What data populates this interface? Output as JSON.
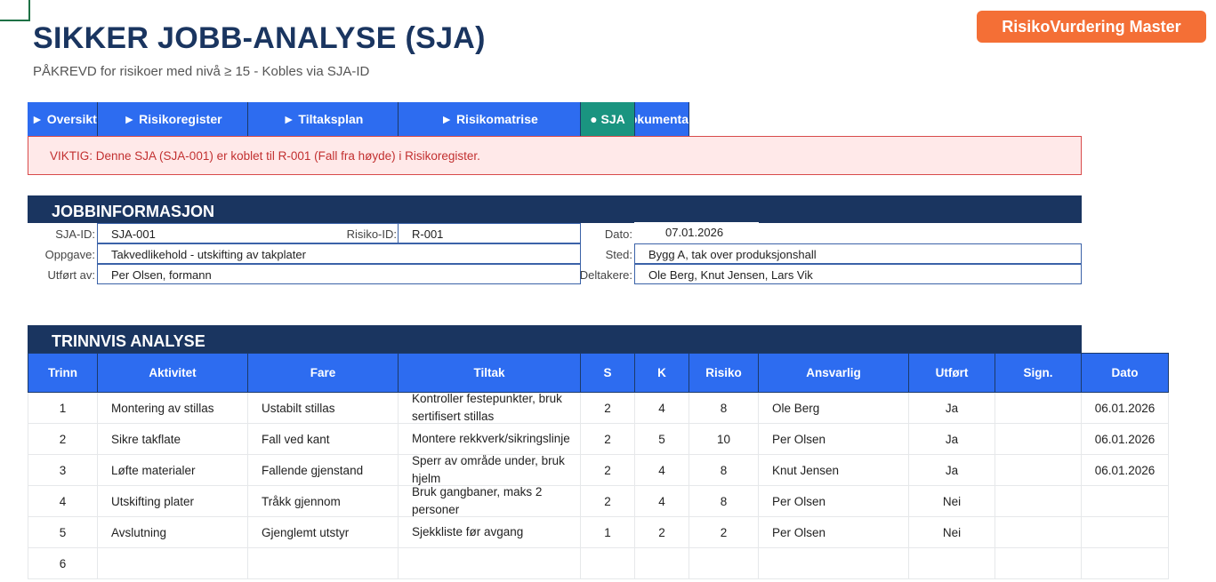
{
  "header": {
    "title": "SIKKER JOBB-ANALYSE (SJA)",
    "subtitle": "PÅKREVD for risikoer med nivå ≥ 15 - Kobles via SJA-ID",
    "brand": "RisikoVurdering Master"
  },
  "nav": {
    "tabs": [
      {
        "label": "► Oversikt"
      },
      {
        "label": "► Risikoregister"
      },
      {
        "label": "► Tiltaksplan"
      },
      {
        "label": "► Risikomatrise"
      },
      {
        "label": "● SJA"
      },
      {
        "label": "Dokumenta"
      }
    ]
  },
  "alert": {
    "text": "VIKTIG: Denne SJA (SJA-001) er koblet til R-001 (Fall fra høyde) i Risikoregister."
  },
  "jobinfo": {
    "heading": "JOBBINFORMASJON",
    "sja_id_label": "SJA-ID:",
    "sja_id": "SJA-001",
    "risk_id_label": "Risiko-ID:",
    "risk_id": "R-001",
    "date_label": "Dato:",
    "date": "07.01.2026",
    "task_label": "Oppgave:",
    "task": "Takvedlikehold - utskifting av takplater",
    "place_label": "Sted:",
    "place": "Bygg A, tak over produksjonshall",
    "by_label": "Utført av:",
    "by": "Per Olsen, formann",
    "participants_label": "Deltakere:",
    "participants": "Ole Berg, Knut Jensen, Lars Vik"
  },
  "analysis": {
    "heading": "TRINNVIS ANALYSE",
    "columns": [
      "Trinn",
      "Aktivitet",
      "Fare",
      "Tiltak",
      "S",
      "K",
      "Risiko",
      "Ansvarlig",
      "Utført",
      "Sign.",
      "Dato"
    ],
    "rows": [
      {
        "step": "1",
        "activity": "Montering av stillas",
        "hazard": "Ustabilt stillas",
        "measure": "Kontroller festepunkter, bruk sertifisert stillas",
        "s": "2",
        "k": "4",
        "risk": "8",
        "responsible": "Ole Berg",
        "done": "Ja",
        "sign": "",
        "date": "06.01.2026"
      },
      {
        "step": "2",
        "activity": "Sikre takflate",
        "hazard": "Fall ved kant",
        "measure": "Montere rekkverk/sikringslinje",
        "s": "2",
        "k": "5",
        "risk": "10",
        "responsible": "Per Olsen",
        "done": "Ja",
        "sign": "",
        "date": "06.01.2026"
      },
      {
        "step": "3",
        "activity": "Løfte materialer",
        "hazard": "Fallende gjenstand",
        "measure": "Sperr av område under, bruk hjelm",
        "s": "2",
        "k": "4",
        "risk": "8",
        "responsible": "Knut Jensen",
        "done": "Ja",
        "sign": "",
        "date": "06.01.2026"
      },
      {
        "step": "4",
        "activity": "Utskifting plater",
        "hazard": "Tråkk gjennom",
        "measure": "Bruk gangbaner, maks 2 personer",
        "s": "2",
        "k": "4",
        "risk": "8",
        "responsible": "Per Olsen",
        "done": "Nei",
        "sign": "",
        "date": ""
      },
      {
        "step": "5",
        "activity": "Avslutning",
        "hazard": "Gjenglemt utstyr",
        "measure": "Sjekkliste før avgang",
        "s": "1",
        "k": "2",
        "risk": "2",
        "responsible": "Per Olsen",
        "done": "Nei",
        "sign": "",
        "date": ""
      },
      {
        "step": "6",
        "activity": "",
        "hazard": "",
        "measure": "",
        "s": "",
        "k": "",
        "risk": "",
        "responsible": "",
        "done": "",
        "sign": "",
        "date": ""
      }
    ]
  }
}
